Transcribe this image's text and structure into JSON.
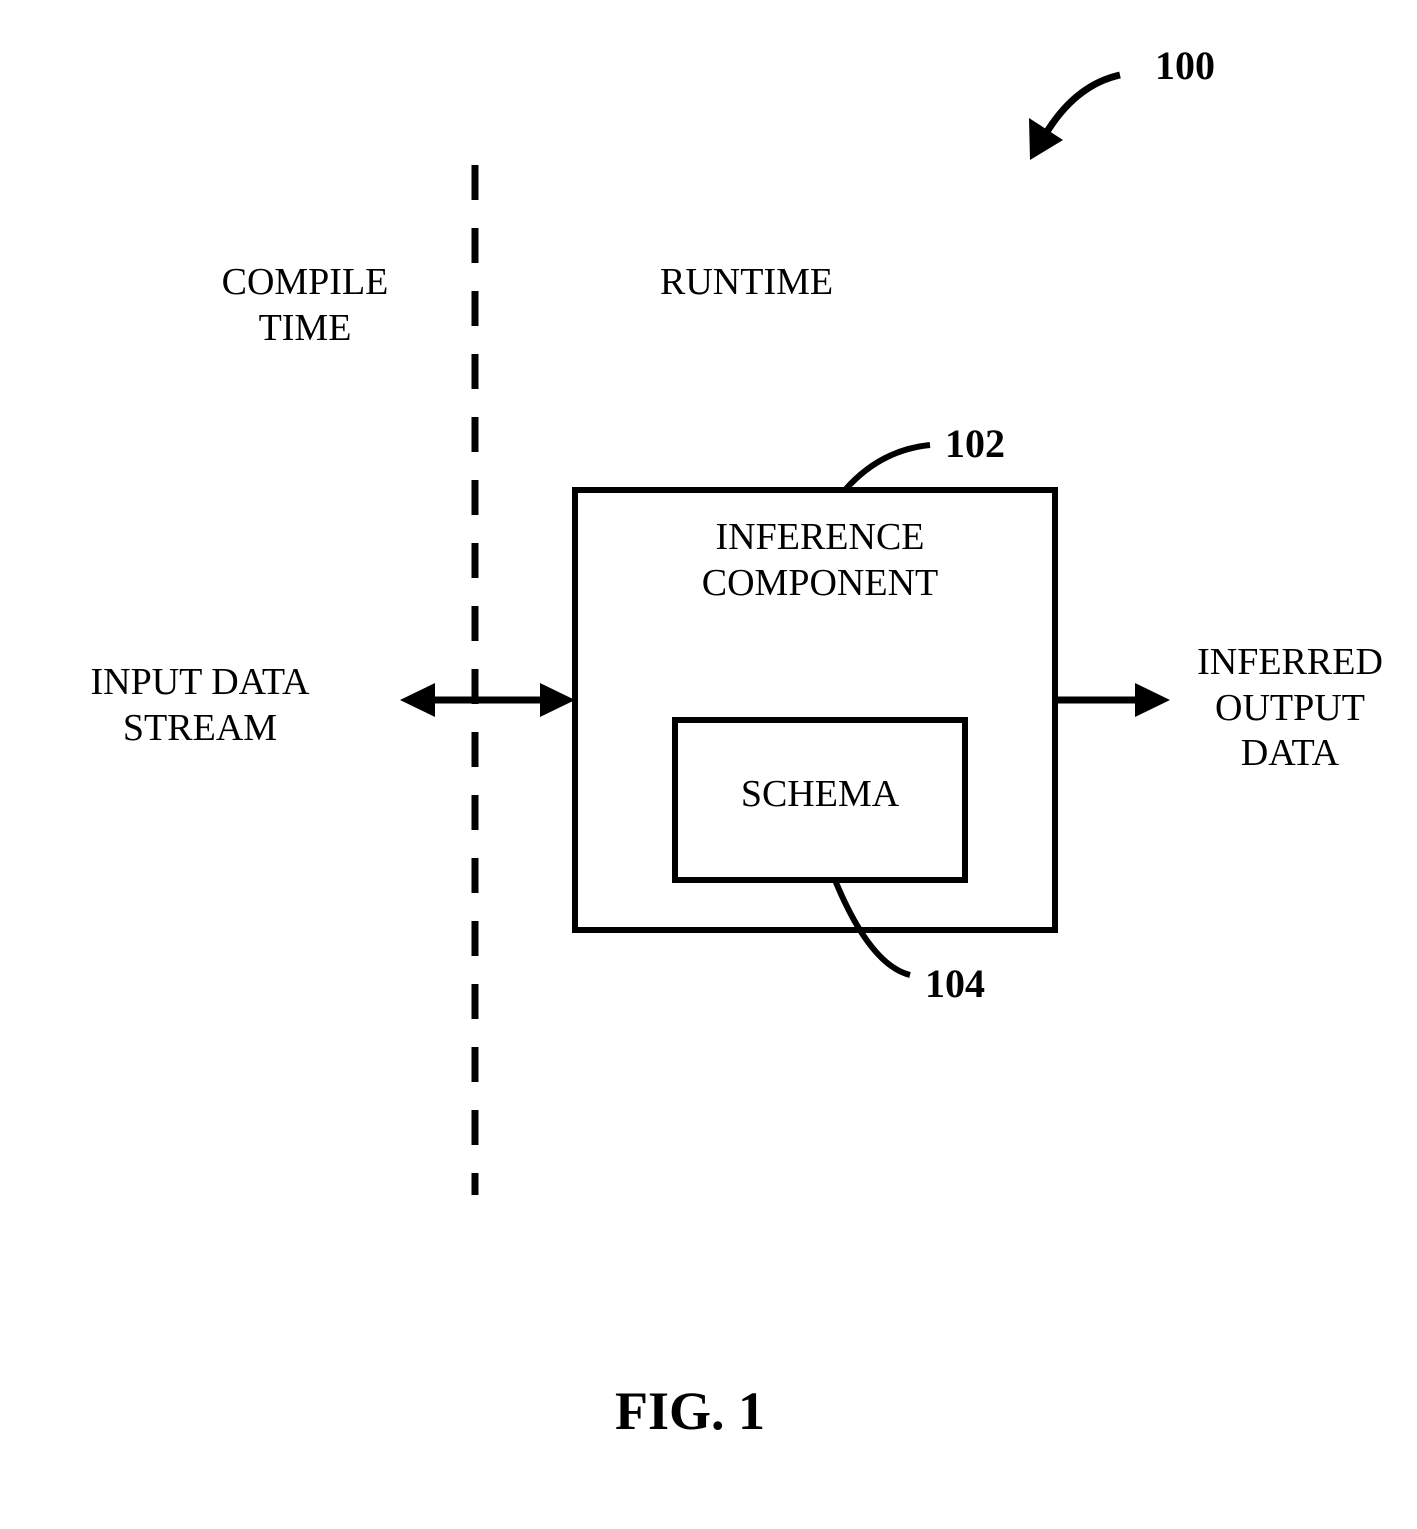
{
  "labels": {
    "compile_time": "COMPILE\nTIME",
    "runtime": "RUNTIME",
    "input_data_stream": "INPUT DATA\nSTREAM",
    "inference_component": "INFERENCE\nCOMPONENT",
    "schema": "SCHEMA",
    "inferred_output_data": "INFERRED\nOUTPUT\nDATA"
  },
  "refs": {
    "r100": "100",
    "r102": "102",
    "r104": "104"
  },
  "caption": "FIG. 1"
}
